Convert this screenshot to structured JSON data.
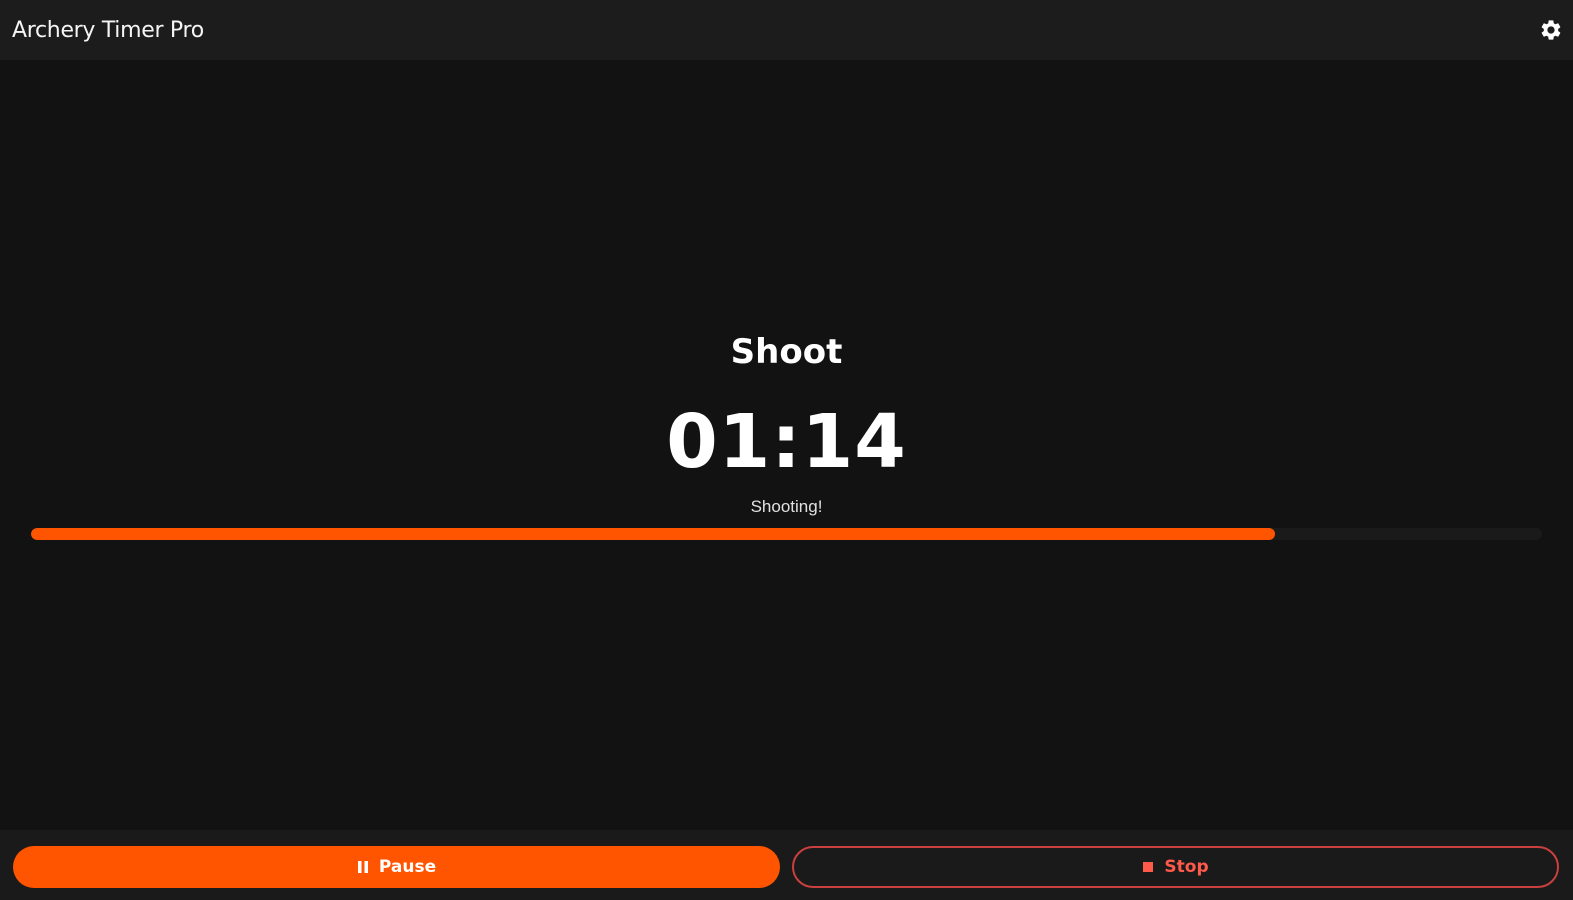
{
  "app": {
    "title": "Archery Timer Pro",
    "settings_icon": "gear-icon"
  },
  "timer": {
    "phase": "Shoot",
    "time": "01:14",
    "status": "Shooting!",
    "progress_fraction": 0.823
  },
  "controls": {
    "pause_label": "Pause",
    "pause_icon": "pause-icon",
    "stop_label": "Stop",
    "stop_icon": "stop-icon"
  },
  "colors": {
    "accent": "#ff5500",
    "stop": "#ff5a4a",
    "background": "#121212",
    "titlebar": "#1c1c1c"
  }
}
